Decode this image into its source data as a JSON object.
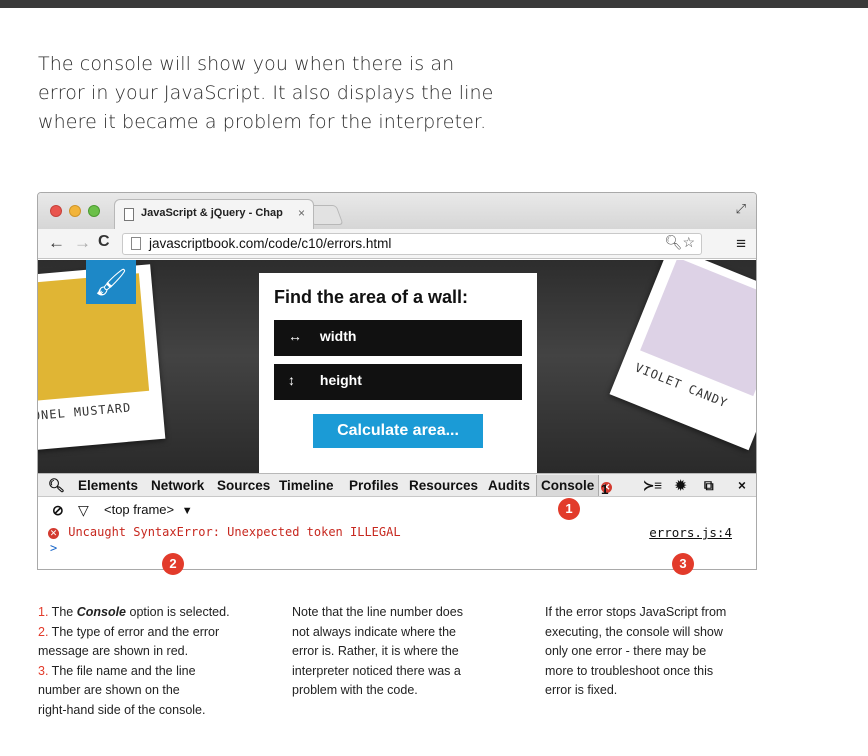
{
  "intro": {
    "line1": "The console will show you when there is an",
    "line2": "error in your JavaScript. It also displays the line",
    "line3": "where it became a problem for the interpreter."
  },
  "browser": {
    "tab_title": "JavaScript & jQuery - Chap",
    "tab_close": "×",
    "url": "javascriptbook.com/code/c10/errors.html",
    "back_glyph": "←",
    "forward_glyph": "→",
    "reload_glyph": "C",
    "omni_icons": "🔍︎☆",
    "menu_glyph": "≡",
    "fullscreen_glyph": "⤢"
  },
  "page": {
    "heading": "Find the area of a wall:",
    "width_label": "width",
    "width_icon": "↔",
    "height_label": "height",
    "height_icon": "↕",
    "calculate_label": "Calculate area...",
    "swatch_left_label": "ONEL MUSTARD",
    "swatch_right_label": "VIOLET CANDY",
    "brush_glyph": "🖌︎"
  },
  "devtools": {
    "tabs": [
      "Elements",
      "Network",
      "Sources",
      "Timeline",
      "Profiles",
      "Resources",
      "Audits",
      "Console"
    ],
    "error_count": "1",
    "frame_label": "<top frame>",
    "dropdown_glyph": "▼",
    "clear_glyph": "⃠",
    "filter_glyph": "▽",
    "drawer_glyph": "≻≡",
    "settings_glyph": "✹",
    "dock_glyph": "⧉",
    "close_glyph": "×",
    "error_message": "Uncaught SyntaxError: Unexpected token ILLEGAL",
    "error_source": "errors.js:4",
    "prompt_glyph": ">"
  },
  "callouts": [
    "1",
    "2",
    "3"
  ],
  "captions": {
    "col1": {
      "n1": "1.",
      "n1_pre": " The ",
      "n1_em": "Console",
      "n1_post": " option is selected.",
      "n2": "2.",
      "n2_text": " The type of error and the error",
      "n2_text2": "message are shown in red.",
      "n3": "3.",
      "n3_text": " The file name and the line",
      "n3_text2": "number are shown on the",
      "n3_text3": "right-hand side of the console."
    },
    "col2": [
      "Note that the line number does",
      "not always  indicate where the",
      "error is. Rather, it is where the",
      "interpreter noticed there was a",
      "problem with the code."
    ],
    "col3": [
      "If the error stops JavaScript from",
      "executing, the console will show",
      "only one error - there may be",
      "more to troubleshoot once this",
      "error is fixed."
    ]
  }
}
